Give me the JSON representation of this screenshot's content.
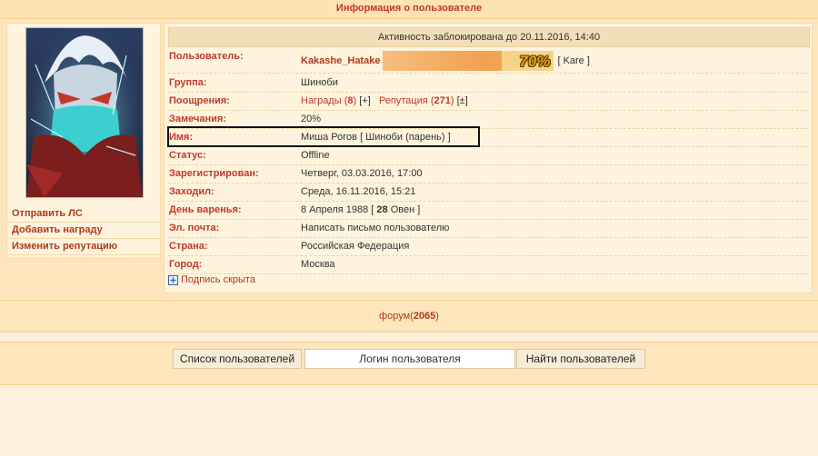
{
  "header": {
    "title": "Информация о пользователе"
  },
  "left": {
    "links": [
      "Отправить ЛС",
      "Добавить награду",
      "Изменить репутацию"
    ]
  },
  "profile": {
    "blocked_notice": "Активность заблокирована до 20.11.2016, 14:40",
    "user_label": "Пользователь:",
    "username": "Kakashe_Hatake",
    "rank_percent": "70%",
    "rank_percent_value": 70,
    "rank_title": "[ Kare ]",
    "group_label": "Группа:",
    "group": "Шиноби",
    "rewards_label": "Поощрения:",
    "rewards_text": "Награды (",
    "rewards_count": "8",
    "rewards_close": ")",
    "rewards_add": "[+]",
    "reputation_text": "Репутация (",
    "reputation_count": "271",
    "reputation_close": ")",
    "reputation_change": "[±]",
    "warnings_label": "Замечания:",
    "warnings": "20%",
    "name_label": "Имя:",
    "name": "Миша Рогов [ Шиноби (парень) ]",
    "status_label": "Статус:",
    "status": "Offline",
    "registered_label": "Зарегистрирован:",
    "registered": "Четверг, 03.03.2016, 17:00",
    "visited_label": "Заходил:",
    "visited": "Среда, 16.11.2016, 15:21",
    "birthday_label": "День варенья:",
    "birthday_prefix": "8 Апреля 1988 [ ",
    "birthday_age": "28",
    "birthday_suffix": " Овен ]",
    "email_label": "Эл. почта:",
    "email_link": "Написать письмо пользователю",
    "country_label": "Страна:",
    "country": "Российская Федерация",
    "city_label": "Город:",
    "city": "Москва",
    "signature_toggle": "Подпись скрыта"
  },
  "forum": {
    "label": "форум(",
    "count": "2065",
    "close": ")"
  },
  "search": {
    "list_button": "Список пользователей",
    "login_placeholder": "Логин пользователя",
    "find_button": "Найти пользователей"
  }
}
